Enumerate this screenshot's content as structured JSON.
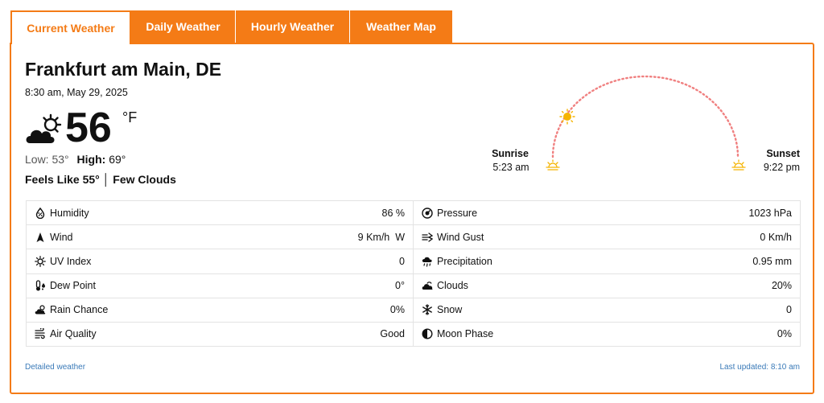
{
  "tabs": [
    {
      "label": "Current Weather",
      "active": true
    },
    {
      "label": "Daily Weather",
      "active": false
    },
    {
      "label": "Hourly Weather",
      "active": false
    },
    {
      "label": "Weather Map",
      "active": false
    }
  ],
  "location": "Frankfurt am Main, DE",
  "datetime": "8:30 am, May 29, 2025",
  "condition_icon": "partly-cloudy-day-icon",
  "temperature": "56",
  "unit": "°F",
  "low_label": "Low: 53°",
  "high_label": "High:",
  "high_value": "69°",
  "feels_like": "Feels Like 55° │ Few Clouds",
  "sun": {
    "sunrise_label": "Sunrise",
    "sunrise_time": "5:23 am",
    "sunset_label": "Sunset",
    "sunset_time": "9:22 pm",
    "arc_color": "#f08080",
    "sun_color": "#f5b400"
  },
  "details_left": [
    {
      "label": "Humidity",
      "value": "86 %",
      "icon": "humidity-icon"
    },
    {
      "label": "Wind",
      "value": "9 Km/h  W",
      "icon": "wind-direction-icon"
    },
    {
      "label": "UV Index",
      "value": "0",
      "icon": "uv-index-icon"
    },
    {
      "label": "Dew Point",
      "value": "0°",
      "icon": "dew-point-icon"
    },
    {
      "label": "Rain Chance",
      "value": "0%",
      "icon": "rain-chance-icon"
    },
    {
      "label": "Air Quality",
      "value": "Good",
      "icon": "air-quality-icon"
    }
  ],
  "details_right": [
    {
      "label": "Pressure",
      "value": "1023 hPa",
      "icon": "pressure-icon"
    },
    {
      "label": "Wind Gust",
      "value": "0 Km/h",
      "icon": "wind-gust-icon"
    },
    {
      "label": "Precipitation",
      "value": "0.95 mm",
      "icon": "precipitation-icon"
    },
    {
      "label": "Clouds",
      "value": "20%",
      "icon": "clouds-icon"
    },
    {
      "label": "Snow",
      "value": "0",
      "icon": "snow-icon"
    },
    {
      "label": "Moon Phase",
      "value": "0%",
      "icon": "moon-phase-icon"
    }
  ],
  "footer": {
    "detailed_link": "Detailed weather",
    "last_updated": "Last updated: 8:10 am"
  },
  "colors": {
    "accent": "#f47b16",
    "link": "#3a7ab8"
  }
}
